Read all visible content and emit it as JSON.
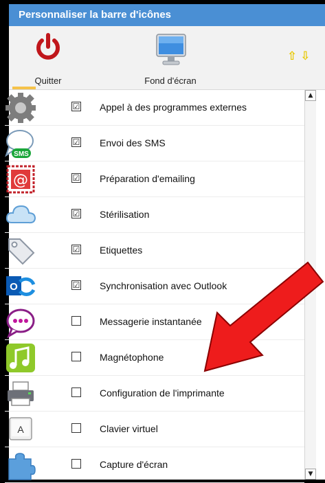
{
  "window": {
    "title": "Personnaliser la barre d'icônes"
  },
  "toolbar": {
    "quit_label": "Quitter",
    "wallpaper_label": "Fond d'écran",
    "move_up": "⇧",
    "move_down": "⇩"
  },
  "items": [
    {
      "label": "Appel à des programmes externes",
      "checked": true,
      "check": "☑",
      "icon": "gear-icon"
    },
    {
      "label": "Envoi des SMS",
      "checked": true,
      "check": "☑",
      "icon": "sms-icon",
      "icon_text": "SMS"
    },
    {
      "label": "Préparation d'emailing",
      "checked": true,
      "check": "☑",
      "icon": "at-stamp-icon",
      "icon_text": "@"
    },
    {
      "label": "Stérilisation",
      "checked": true,
      "check": "☑",
      "icon": "cloud-icon"
    },
    {
      "label": "Etiquettes",
      "checked": true,
      "check": "☑",
      "icon": "tag-icon"
    },
    {
      "label": "Synchronisation avec Outlook",
      "checked": true,
      "check": "☑",
      "icon": "outlook-sync-icon",
      "icon_text": "O"
    },
    {
      "label": "Messagerie instantanée",
      "checked": false,
      "check": "",
      "icon": "chat-bubble-icon"
    },
    {
      "label": "Magnétophone",
      "checked": false,
      "check": "",
      "icon": "music-note-icon"
    },
    {
      "label": "Configuration de l'imprimante",
      "checked": false,
      "check": "",
      "icon": "printer-icon"
    },
    {
      "label": "Clavier virtuel",
      "checked": false,
      "check": "",
      "icon": "keyboard-key-icon",
      "icon_text": "A"
    },
    {
      "label": "Capture d'écran",
      "checked": false,
      "check": "",
      "icon": "puzzle-icon"
    }
  ],
  "colors": {
    "title_bar": "#4a8fd4",
    "annotation_arrow": "#ee1c1c",
    "quit_icon": "#c0161b"
  },
  "scrollbar": {
    "up": "▲",
    "down": "▼"
  }
}
